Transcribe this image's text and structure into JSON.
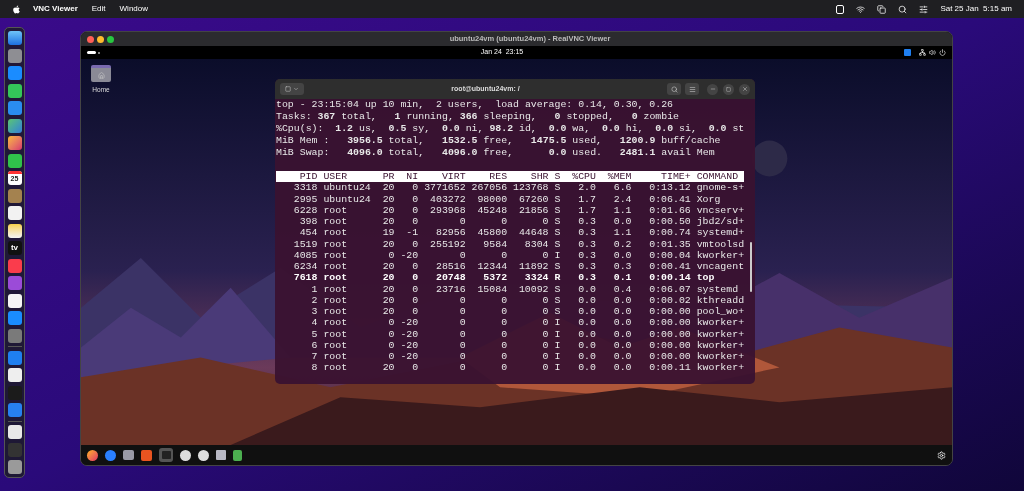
{
  "menu_bar": {
    "app_name": "VNC Viewer",
    "menus": [
      "Edit",
      "Window"
    ],
    "clock": "Sat 25 Jan  5:15 am"
  },
  "dock": {
    "calendar_day": "25",
    "tv_label": "tv"
  },
  "vnc_window": {
    "title": "ubuntu24vm (ubuntu24vm) - RealVNC Viewer",
    "ubuntu_top_bar": {
      "clock": "Jan 24  23:15"
    },
    "desktop_icons": [
      {
        "label": "Home"
      }
    ],
    "terminal": {
      "title": "root@ubuntu24vm: /",
      "summary": [
        "top - 23:15:04 up 10 min,  2 users,  load average: 0.14, 0.30, 0.26",
        "Tasks: **367** total,   **1** running, **366** sleeping,   **0** stopped,   **0** zombie",
        "%Cpu(s):  **1.2** us,  **0.5** sy,  **0.0** ni, **98.2** id,  **0.0** wa,  **0.0** hi,  **0.0** si,  **0.0** st",
        "MiB Mem :   **3956.5** total,   **1532.5** free,   **1475.5** used,   **1200.9** buff/cache",
        "MiB Swap:   **4096.0** total,   **4096.0** free,      **0.0** used.   **2481.1** avail Mem"
      ],
      "columns": [
        "PID",
        "USER",
        "PR",
        "NI",
        "VIRT",
        "RES",
        "SHR",
        "S",
        "%CPU",
        "%MEM",
        "TIME+",
        "COMMAND"
      ],
      "rows": [
        {
          "cells": [
            "3318",
            "ubuntu24",
            "20",
            "0",
            "3771652",
            "267056",
            "123768",
            "S",
            "2.0",
            "6.6",
            "0:13.12",
            "gnome-s+"
          ],
          "highlighted": false
        },
        {
          "cells": [
            "2995",
            "ubuntu24",
            "20",
            "0",
            "403272",
            "98000",
            "67260",
            "S",
            "1.7",
            "2.4",
            "0:06.41",
            "Xorg"
          ],
          "highlighted": false
        },
        {
          "cells": [
            "6228",
            "root",
            "20",
            "0",
            "293968",
            "45248",
            "21856",
            "S",
            "1.7",
            "1.1",
            "0:01.66",
            "vncserv+"
          ],
          "highlighted": false
        },
        {
          "cells": [
            "398",
            "root",
            "20",
            "0",
            "0",
            "0",
            "0",
            "S",
            "0.3",
            "0.0",
            "0:00.50",
            "jbd2/sd+"
          ],
          "highlighted": false
        },
        {
          "cells": [
            "454",
            "root",
            "19",
            "-1",
            "82956",
            "45800",
            "44648",
            "S",
            "0.3",
            "1.1",
            "0:00.74",
            "systemd+"
          ],
          "highlighted": false
        },
        {
          "cells": [
            "1519",
            "root",
            "20",
            "0",
            "255192",
            "9584",
            "8304",
            "S",
            "0.3",
            "0.2",
            "0:01.35",
            "vmtoolsd"
          ],
          "highlighted": false
        },
        {
          "cells": [
            "4085",
            "root",
            "0",
            "-20",
            "0",
            "0",
            "0",
            "I",
            "0.3",
            "0.0",
            "0:00.04",
            "kworker+"
          ],
          "highlighted": false
        },
        {
          "cells": [
            "6234",
            "root",
            "20",
            "0",
            "28516",
            "12344",
            "11892",
            "S",
            "0.3",
            "0.3",
            "0:00.41",
            "vncagent"
          ],
          "highlighted": false
        },
        {
          "cells": [
            "7618",
            "root",
            "20",
            "0",
            "20748",
            "5372",
            "3324",
            "R",
            "0.3",
            "0.1",
            "0:00.14",
            "top"
          ],
          "highlighted": true
        },
        {
          "cells": [
            "1",
            "root",
            "20",
            "0",
            "23716",
            "15084",
            "10092",
            "S",
            "0.0",
            "0.4",
            "0:06.07",
            "systemd"
          ],
          "highlighted": false
        },
        {
          "cells": [
            "2",
            "root",
            "20",
            "0",
            "0",
            "0",
            "0",
            "S",
            "0.0",
            "0.0",
            "0:00.02",
            "kthreadd"
          ],
          "highlighted": false
        },
        {
          "cells": [
            "3",
            "root",
            "20",
            "0",
            "0",
            "0",
            "0",
            "S",
            "0.0",
            "0.0",
            "0:00.00",
            "pool_wo+"
          ],
          "highlighted": false
        },
        {
          "cells": [
            "4",
            "root",
            "0",
            "-20",
            "0",
            "0",
            "0",
            "I",
            "0.0",
            "0.0",
            "0:00.00",
            "kworker+"
          ],
          "highlighted": false
        },
        {
          "cells": [
            "5",
            "root",
            "0",
            "-20",
            "0",
            "0",
            "0",
            "I",
            "0.0",
            "0.0",
            "0:00.00",
            "kworker+"
          ],
          "highlighted": false
        },
        {
          "cells": [
            "6",
            "root",
            "0",
            "-20",
            "0",
            "0",
            "0",
            "I",
            "0.0",
            "0.0",
            "0:00.00",
            "kworker+"
          ],
          "highlighted": false
        },
        {
          "cells": [
            "7",
            "root",
            "0",
            "-20",
            "0",
            "0",
            "0",
            "I",
            "0.0",
            "0.0",
            "0:00.00",
            "kworker+"
          ],
          "highlighted": false
        },
        {
          "cells": [
            "8",
            "root",
            "20",
            "0",
            "0",
            "0",
            "0",
            "I",
            "0.0",
            "0.0",
            "0:00.11",
            "kworker+"
          ],
          "highlighted": false
        }
      ]
    }
  }
}
